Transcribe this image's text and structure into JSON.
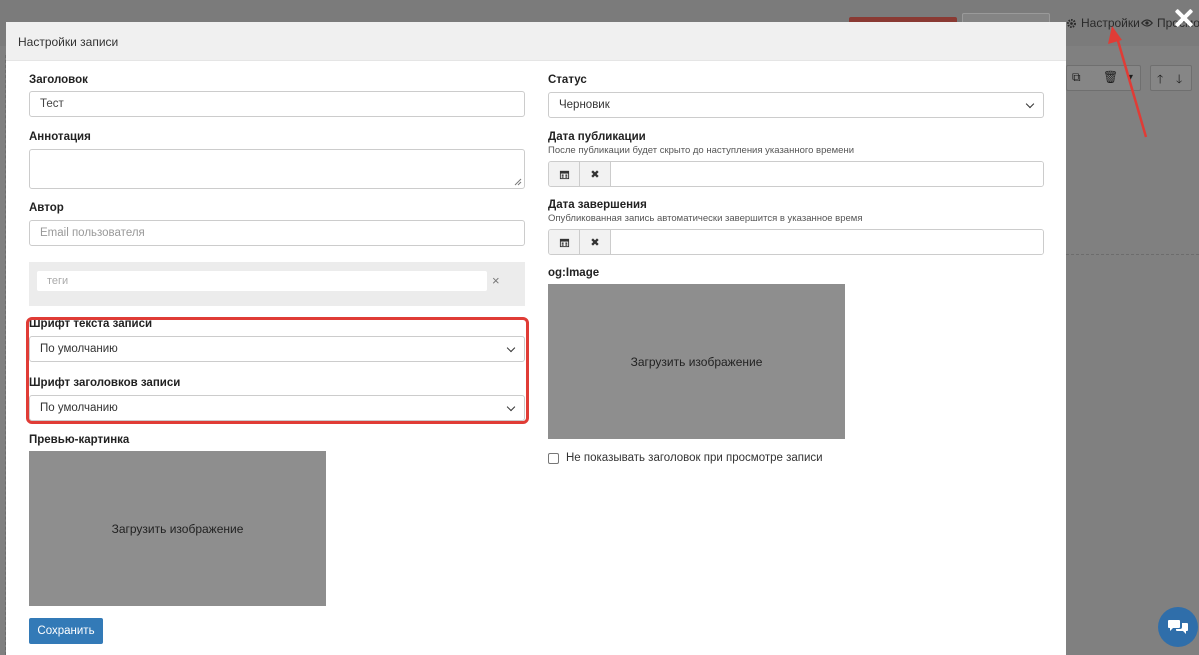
{
  "background": {
    "settings_label": "Настройки",
    "preview_label": "Просмот"
  },
  "modal": {
    "title": "Настройки записи",
    "left": {
      "title_label": "Заголовок",
      "title_value": "Тест",
      "annotation_label": "Аннотация",
      "author_label": "Автор",
      "author_placeholder": "Email пользователя",
      "tags_placeholder": "теги",
      "tags_clear": "×",
      "body_font_label": "Шрифт текста записи",
      "body_font_value": "По умолчанию",
      "heading_font_label": "Шрифт заголовков записи",
      "heading_font_value": "По умолчанию",
      "preview_image_label": "Превью-картинка",
      "preview_upload_text": "Загрузить изображение"
    },
    "right": {
      "status_label": "Статус",
      "status_value": "Черновик",
      "publish_date_label": "Дата публикации",
      "publish_date_hint": "После публикации будет скрыто до наступления указанного времени",
      "end_date_label": "Дата завершения",
      "end_date_hint": "Опубликованная запись автоматически завершится в указанное время",
      "og_image_label": "og:Image",
      "og_upload_text": "Загрузить изображение",
      "hide_title_label": "Не показывать заголовок при просмотре записи"
    },
    "save_label": "Сохранить"
  },
  "colors": {
    "primary": "#337ab7",
    "highlight": "#e03c36",
    "overlay": "#808080"
  }
}
